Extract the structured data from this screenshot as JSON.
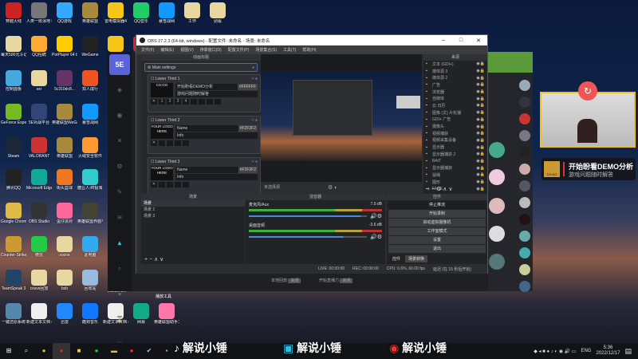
{
  "desktop_icons": [
    {
      "label": "穿越火线",
      "color": "#c22"
    },
    {
      "label": "人类一败涂地 Human Fa...",
      "color": "#777"
    },
    {
      "label": "QQ游戏",
      "color": "#3af"
    },
    {
      "label": "英雄联盟",
      "color": "#a88a3c"
    },
    {
      "label": "雷电模拟器4",
      "color": "#f5c518"
    },
    {
      "label": "QQ音乐",
      "color": "#2c6"
    },
    {
      "label": "暴雪战网",
      "color": "#19f"
    },
    {
      "label": "工作",
      "color": "#e8d7a0"
    },
    {
      "label": "别看",
      "color": "#e8d7a0"
    },
    {
      "label": "每天500元斗记录",
      "color": "#e8d7a0"
    },
    {
      "label": "QQ招聘",
      "color": "#fa3"
    },
    {
      "label": "PotPlayer 64 bit",
      "color": "#fc0"
    },
    {
      "label": "WeGame",
      "color": "#222"
    },
    {
      "label": "雷电多开",
      "color": "#f5c518"
    },
    {
      "label": "WPS Office",
      "color": "#d22"
    },
    {
      "label": "控制面板",
      "color": "#4ad"
    },
    {
      "label": "ssr",
      "color": "#e8d7a0"
    },
    {
      "label": "5c310dc8...",
      "color": "#636"
    },
    {
      "label": "双人成行",
      "color": "#e52"
    },
    {
      "label": "GeForce Experience",
      "color": "#7b2"
    },
    {
      "label": "5E对战平台",
      "color": "#347"
    },
    {
      "label": "英雄联盟WeGame版",
      "color": "#a88a3c"
    },
    {
      "label": "暴雪战网",
      "color": "#19f"
    },
    {
      "label": "Steam",
      "color": "#1b2838"
    },
    {
      "label": "VALORANT",
      "color": "#c33"
    },
    {
      "label": "英雄联盟",
      "color": "#a88a3c"
    },
    {
      "label": "火绒安全软件",
      "color": "#f93"
    },
    {
      "label": "腾讯QQ",
      "color": "#222"
    },
    {
      "label": "Microsoft Edge",
      "color": "#1a9"
    },
    {
      "label": "街头篮球",
      "color": "#e72"
    },
    {
      "label": "糖豆人:终极淘汰赛",
      "color": "#3cc"
    },
    {
      "label": "Google Chrome",
      "color": "#db4"
    },
    {
      "label": "OBS Studio",
      "color": "#333"
    },
    {
      "label": "蛋仔派对",
      "color": "#f69"
    },
    {
      "label": "英雄联盟界面平台",
      "color": "#443"
    },
    {
      "label": "Counter-Strike Global Off...",
      "color": "#c93"
    },
    {
      "label": "微信",
      "color": "#2c4"
    },
    {
      "label": "zoone",
      "color": "#e8d7a0"
    },
    {
      "label": "此电脑",
      "color": "#3ae"
    },
    {
      "label": "TeamSpeak 3",
      "color": "#246"
    },
    {
      "label": "cssve回放",
      "color": "#e8d7a0"
    },
    {
      "label": "bxb",
      "color": "#e8d7a0"
    },
    {
      "label": "回收站",
      "color": "#9bd"
    },
    {
      "label": "一键还原系统",
      "color": "#58a"
    },
    {
      "label": "新建文本文档 (4)",
      "color": "#eee"
    },
    {
      "label": "迅雷",
      "color": "#28f"
    },
    {
      "label": "酷狗音乐",
      "color": "#17f"
    },
    {
      "label": "新建文本文档 (3)",
      "color": "#eee"
    },
    {
      "label": "网易",
      "color": "#1a8"
    },
    {
      "label": "英雄联盟助手工具",
      "color": "#f7a"
    }
  ],
  "desktop_extra": {
    "folder1": "2021072...",
    "folder2": "播放工具"
  },
  "obs": {
    "title": "OBS 27.2.3 (64-bit, windows) - 配置文件: 未命名 - 场景: 未命名",
    "menu": [
      "文件(F)",
      "编辑(E)",
      "视图(V)",
      "停靠窗口(D)",
      "配置文件(P)",
      "场景集合(S)",
      "工具(T)",
      "帮助(H)"
    ],
    "lower_thirds_title": "动画标题",
    "main_settings": "Main settings",
    "lower_thirds": [
      {
        "name": "Lower Third 1",
        "logo": "CS:GO",
        "line1": "开始盼看DEMO分析",
        "line2": "游戏问题随时解答",
        "color": "#FFFFFF"
      },
      {
        "name": "Lower Third 2",
        "logo": "YOUR LOGO HERE",
        "line1": "Name",
        "line2": "Info",
        "color": "#F2F2F2"
      },
      {
        "name": "Lower Third 3",
        "logo": "YOUR LOGO HERE",
        "line1": "Name",
        "line2": "Info",
        "color": "#F2F2F2"
      }
    ],
    "slots": [
      "1",
      "2",
      "3",
      "4"
    ],
    "no_source": "未选择源",
    "sources_title": "来源",
    "sources": [
      "文本 (GDI+)",
      "媒体源 3",
      "媒体源 2",
      "广告",
      "浏览器",
      "自媒体",
      "云 日历",
      "图像 (文) 片轮播",
      "GDI+ 广告",
      "摄像头",
      "视频捕获",
      "视频采集设备",
      "显示器",
      "显示器捕获 2",
      "BAIT",
      "显示器捕获",
      "鼠绳",
      "图形",
      "FACE"
    ],
    "scenes_title": "场景",
    "scenes": [
      "场景",
      "场景 2",
      "场景 3"
    ],
    "mixer_title": "混音器",
    "mixer": [
      {
        "name": "麦克风/Aux",
        "db": "7.0 dB",
        "level": 0.95
      },
      {
        "name": "桌面音频",
        "db": "-3.6 dB",
        "level": 0.8
      }
    ],
    "controls_title": "控件",
    "controls": [
      "停止推流",
      "开始录制",
      "启动虚拟摄像机",
      "工作室模式",
      "设置",
      "退出"
    ],
    "tabs": [
      "控件",
      "场景转换"
    ],
    "status": {
      "live": "LIVE: 00:00:00",
      "rec": "REC: 00:00:00",
      "cpu": "CPU: 6.6%, 60.00 fps",
      "delay": "延迟 (在 15 秒后开始)"
    }
  },
  "app5e": {
    "local_replay": "本地回放",
    "local_replay_state": "关闭",
    "stream": "开始直播力",
    "stream_state": "关闭"
  },
  "overlay": {
    "banner_title": "开始盼看DEMO分析",
    "banner_sub": "游戏问题随时解答",
    "badge": "CS:GO"
  },
  "watermarks": [
    "解说小锤",
    "解说小锤",
    "解说小锤"
  ],
  "taskbar": {
    "lang": "ENG",
    "time": "5:36",
    "date": "2022/12/17"
  }
}
